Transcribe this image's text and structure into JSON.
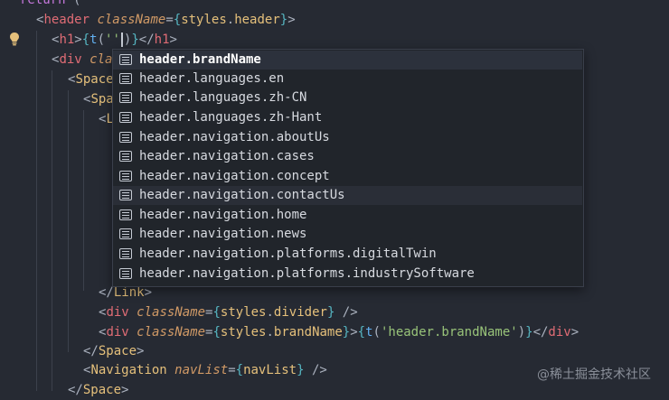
{
  "editor": {
    "lines": {
      "l0": {
        "kw": "return",
        "punct": " ("
      },
      "l1": {
        "open": "<",
        "tag": "header",
        "attr": "className",
        "eq": "=",
        "lb": "{",
        "ident": "styles",
        "dot": ".",
        "prop": "header",
        "rb": "}",
        "close": ">"
      },
      "l2": {
        "open": "<",
        "tag": "h1",
        "gt": ">",
        "lb": "{",
        "fn": "t",
        "paren_open": "(",
        "str": "''",
        "paren_close": ")",
        "rb": "}",
        "close_tag": "</",
        "tag2": "h1",
        "gt2": ">"
      },
      "l3": {
        "open": "<",
        "tag": "div",
        "attr": "cla"
      },
      "l4": {
        "open": "<",
        "tag": "Space"
      },
      "l5": {
        "open": "<",
        "tag": "Spa"
      },
      "l6": {
        "open": "<",
        "tag": "L"
      },
      "l7": {
        "open": "</",
        "tag": "Link",
        "gt": ">"
      },
      "l8": {
        "open": "<",
        "tag": "div",
        "attr": "className",
        "eq": "=",
        "lb": "{",
        "ident": "styles",
        "dot": ".",
        "prop": "divider",
        "rb": "}",
        "close": " />"
      },
      "l9": {
        "open": "<",
        "tag": "div",
        "attr": "className",
        "eq": "=",
        "lb": "{",
        "ident": "styles",
        "dot": ".",
        "prop": "brandName",
        "rb": "}",
        "gt": ">",
        "lb2": "{",
        "fn": "t",
        "paren_open": "(",
        "str": "'header.brandName'",
        "paren_close": ")",
        "rb2": "}",
        "close_tag": "</",
        "tag2": "div",
        "gt2": ">"
      },
      "l10": {
        "open": "</",
        "tag": "Space",
        "gt": ">"
      },
      "l11": {
        "open": "<",
        "tag": "Navigation",
        "attr": "navList",
        "eq": "=",
        "lb": "{",
        "ident": "navList",
        "rb": "}",
        "close": " />"
      },
      "l12": {
        "open": "</",
        "tag": "Space",
        "gt": ">"
      }
    }
  },
  "suggest": {
    "items": [
      {
        "label": "header.brandName"
      },
      {
        "label": "header.languages.en"
      },
      {
        "label": "header.languages.zh-CN"
      },
      {
        "label": "header.languages.zh-Hant"
      },
      {
        "label": "header.navigation.aboutUs"
      },
      {
        "label": "header.navigation.cases"
      },
      {
        "label": "header.navigation.concept"
      },
      {
        "label": "header.navigation.contactUs"
      },
      {
        "label": "header.navigation.home"
      },
      {
        "label": "header.navigation.news"
      },
      {
        "label": "header.navigation.platforms.digitalTwin"
      },
      {
        "label": "header.navigation.platforms.industrySoftware"
      }
    ]
  },
  "watermark": "@稀土掘金技术社区",
  "colors": {
    "background": "#262a33",
    "tag": "#e06c75",
    "attr": "#d19a66",
    "string": "#98c379",
    "function": "#61afef",
    "ident": "#e5c07b"
  }
}
